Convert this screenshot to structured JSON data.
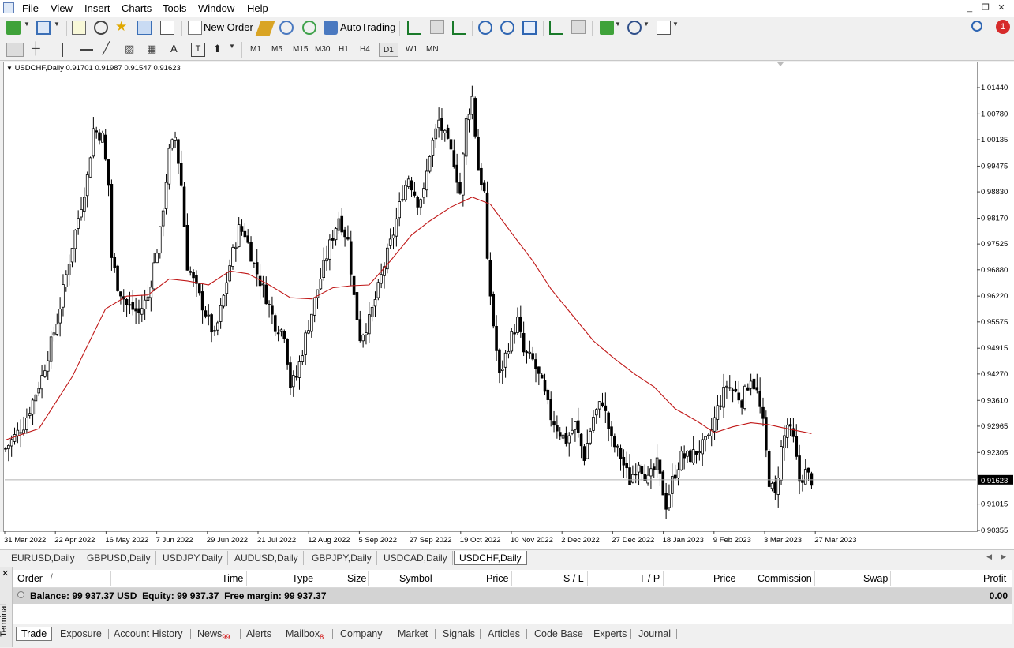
{
  "menu": [
    "File",
    "View",
    "Insert",
    "Charts",
    "Tools",
    "Window",
    "Help"
  ],
  "toolbar": {
    "new_order": "New Order",
    "auto_trading": "AutoTrading",
    "notification_count": "1"
  },
  "timeframes": [
    "M1",
    "M5",
    "M15",
    "M30",
    "H1",
    "H4",
    "D1",
    "W1",
    "MN"
  ],
  "active_timeframe": "D1",
  "chart_header": {
    "symbol": "USDCHF,Daily",
    "open": "0.91701",
    "high": "0.91987",
    "low": "0.91547",
    "close": "0.91623"
  },
  "chart_data": {
    "type": "candlestick",
    "symbol": "USDCHF",
    "timeframe": "Daily",
    "y_ticks": [
      "1.01440",
      "1.00780",
      "1.00135",
      "0.99475",
      "0.98830",
      "0.98170",
      "0.97525",
      "0.96880",
      "0.96220",
      "0.95575",
      "0.94915",
      "0.94270",
      "0.93610",
      "0.92965",
      "0.92305",
      "0.91015",
      "0.90355"
    ],
    "y_range": [
      0.9012,
      1.0168
    ],
    "current_price": "0.91623",
    "x_ticks": [
      "31 Mar 2022",
      "22 Apr 2022",
      "16 May 2022",
      "7 Jun 2022",
      "29 Jun 2022",
      "21 Jul 2022",
      "12 Aug 2022",
      "5 Sep 2022",
      "27 Sep 2022",
      "19 Oct 2022",
      "10 Nov 2022",
      "2 Dec 2022",
      "27 Dec 2022",
      "18 Jan 2023",
      "9 Feb 2023",
      "3 Mar 2023",
      "27 Mar 2023"
    ],
    "close_path": [
      [
        0,
        0.924
      ],
      [
        6,
        0.93
      ],
      [
        12,
        0.942
      ],
      [
        17,
        0.956
      ],
      [
        22,
        0.975
      ],
      [
        27,
        0.992
      ],
      [
        29,
        1.004
      ],
      [
        32,
        1.002
      ],
      [
        34,
        0.99
      ],
      [
        35,
        0.972
      ],
      [
        37,
        0.965
      ],
      [
        40,
        0.96
      ],
      [
        44,
        0.958
      ],
      [
        47,
        0.962
      ],
      [
        51,
        0.978
      ],
      [
        54,
        0.998
      ],
      [
        56,
        1.002
      ],
      [
        58,
        0.99
      ],
      [
        60,
        0.97
      ],
      [
        63,
        0.964
      ],
      [
        66,
        0.958
      ],
      [
        69,
        0.952
      ],
      [
        72,
        0.962
      ],
      [
        74,
        0.97
      ],
      [
        77,
        0.979
      ],
      [
        79,
        0.978
      ],
      [
        82,
        0.97
      ],
      [
        86,
        0.962
      ],
      [
        89,
        0.955
      ],
      [
        92,
        0.953
      ],
      [
        94,
        0.94
      ],
      [
        96,
        0.942
      ],
      [
        99,
        0.952
      ],
      [
        103,
        0.964
      ],
      [
        107,
        0.975
      ],
      [
        110,
        0.982
      ],
      [
        113,
        0.976
      ],
      [
        115,
        0.962
      ],
      [
        117,
        0.952
      ],
      [
        120,
        0.956
      ],
      [
        123,
        0.964
      ],
      [
        125,
        0.97
      ],
      [
        128,
        0.978
      ],
      [
        131,
        0.988
      ],
      [
        133,
        0.992
      ],
      [
        136,
        0.986
      ],
      [
        138,
        0.988
      ],
      [
        140,
        0.998
      ],
      [
        143,
        1.006
      ],
      [
        146,
        1.0
      ],
      [
        148,
        0.996
      ],
      [
        150,
        0.988
      ],
      [
        152,
        1.006
      ],
      [
        154,
        1.012
      ],
      [
        156,
        0.994
      ],
      [
        158,
        0.988
      ],
      [
        159,
        0.97
      ],
      [
        161,
        0.955
      ],
      [
        163,
        0.942
      ],
      [
        166,
        0.95
      ],
      [
        169,
        0.956
      ],
      [
        171,
        0.948
      ],
      [
        174,
        0.946
      ],
      [
        177,
        0.94
      ],
      [
        180,
        0.932
      ],
      [
        183,
        0.928
      ],
      [
        185,
        0.926
      ],
      [
        188,
        0.93
      ],
      [
        191,
        0.922
      ],
      [
        194,
        0.932
      ],
      [
        197,
        0.936
      ],
      [
        200,
        0.926
      ],
      [
        203,
        0.922
      ],
      [
        206,
        0.916
      ],
      [
        209,
        0.921
      ],
      [
        212,
        0.916
      ],
      [
        215,
        0.92
      ],
      [
        218,
        0.91
      ],
      [
        220,
        0.916
      ],
      [
        223,
        0.922
      ],
      [
        226,
        0.922
      ],
      [
        229,
        0.924
      ],
      [
        232,
        0.926
      ],
      [
        235,
        0.934
      ],
      [
        238,
        0.94
      ],
      [
        241,
        0.938
      ],
      [
        243,
        0.936
      ],
      [
        246,
        0.942
      ],
      [
        248,
        0.938
      ],
      [
        250,
        0.93
      ],
      [
        252,
        0.916
      ],
      [
        254,
        0.912
      ],
      [
        256,
        0.924
      ],
      [
        258,
        0.93
      ],
      [
        260,
        0.926
      ],
      [
        262,
        0.916
      ],
      [
        264,
        0.918
      ],
      [
        266,
        0.9162
      ]
    ],
    "moving_average": [
      [
        0,
        0.9262
      ],
      [
        11,
        0.929
      ],
      [
        22,
        0.942
      ],
      [
        33,
        0.959
      ],
      [
        40,
        0.9622
      ],
      [
        47,
        0.9625
      ],
      [
        54,
        0.9665
      ],
      [
        60,
        0.966
      ],
      [
        67,
        0.965
      ],
      [
        74,
        0.9685
      ],
      [
        80,
        0.9678
      ],
      [
        87,
        0.965
      ],
      [
        94,
        0.9618
      ],
      [
        101,
        0.9615
      ],
      [
        108,
        0.9643
      ],
      [
        114,
        0.9648
      ],
      [
        120,
        0.965
      ],
      [
        127,
        0.971
      ],
      [
        134,
        0.9775
      ],
      [
        140,
        0.981
      ],
      [
        147,
        0.9845
      ],
      [
        154,
        0.987
      ],
      [
        160,
        0.9852
      ],
      [
        167,
        0.978
      ],
      [
        174,
        0.971
      ],
      [
        180,
        0.964
      ],
      [
        187,
        0.9575
      ],
      [
        194,
        0.951
      ],
      [
        201,
        0.9465
      ],
      [
        208,
        0.9425
      ],
      [
        214,
        0.9395
      ],
      [
        221,
        0.934
      ],
      [
        228,
        0.931
      ],
      [
        234,
        0.928
      ],
      [
        240,
        0.9295
      ],
      [
        246,
        0.9305
      ],
      [
        252,
        0.93
      ],
      [
        258,
        0.929
      ],
      [
        266,
        0.9278
      ]
    ]
  },
  "chart_tabs": [
    "EURUSD,Daily",
    "GBPUSD,Daily",
    "USDJPY,Daily",
    "AUDUSD,Daily",
    "GBPJPY,Daily",
    "USDCAD,Daily",
    "USDCHF,Daily"
  ],
  "active_chart_tab": "USDCHF,Daily",
  "terminal": {
    "side_label": "Terminal",
    "columns": {
      "order": "Order",
      "sort": "/",
      "time": "Time",
      "type": "Type",
      "size": "Size",
      "symbol": "Symbol",
      "price": "Price",
      "sl": "S / L",
      "tp": "T / P",
      "price2": "Price",
      "commission": "Commission",
      "swap": "Swap",
      "profit": "Profit"
    },
    "balance_text": "Balance: 99 937.37 USD  Equity: 99 937.37  Free margin: 99 937.37",
    "profit": "0.00",
    "tabs": [
      "Trade",
      "Exposure",
      "Account History",
      "News",
      "Alerts",
      "Mailbox",
      "Company",
      "Market",
      "Signals",
      "Articles",
      "Code Base",
      "Experts",
      "Journal"
    ],
    "active_tab": "Trade",
    "news_count": "99",
    "mailbox_count": "8"
  },
  "colors": {
    "ma": "#c01818",
    "candle": "#000000",
    "chart_bg": "#ffffff"
  }
}
